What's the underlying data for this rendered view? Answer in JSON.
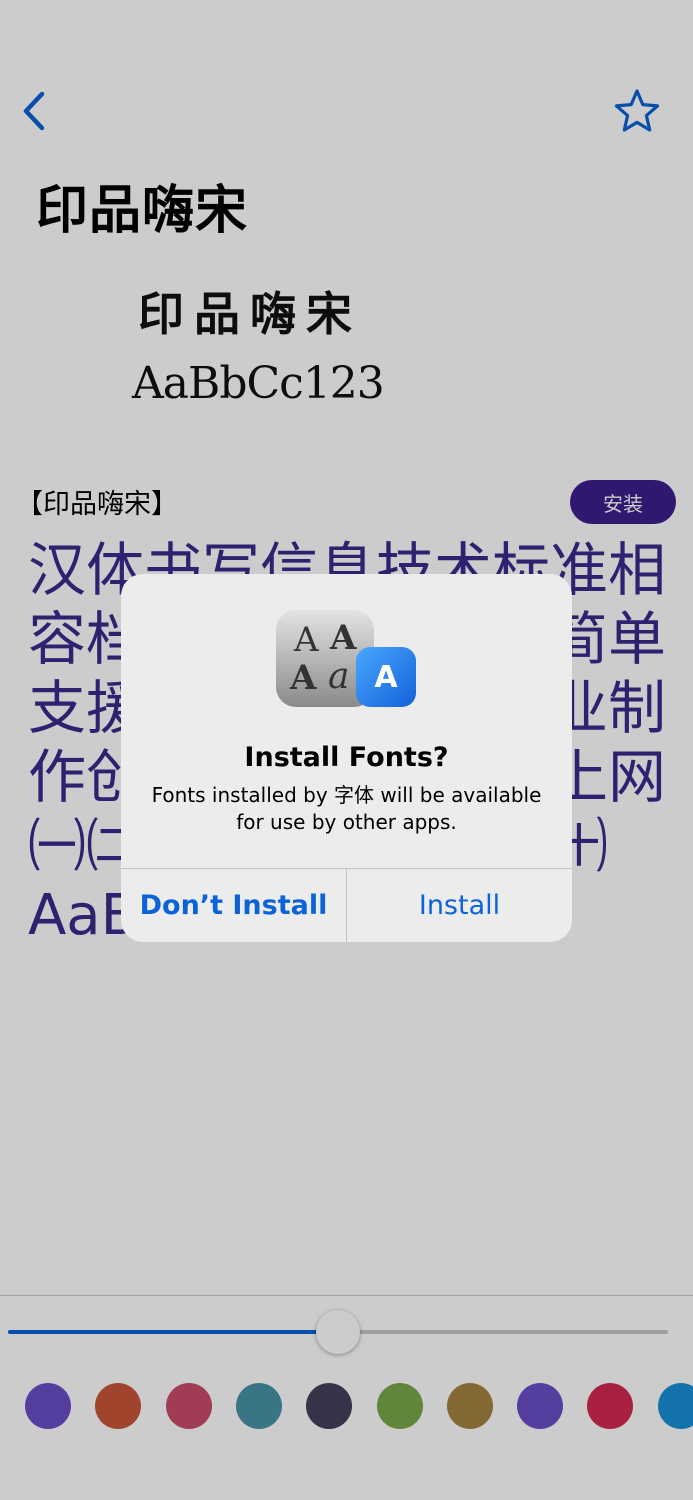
{
  "header": {
    "back_icon": "chevron-left-icon",
    "favorite_icon": "star-outline-icon",
    "title": "印品嗨宋"
  },
  "preview": {
    "chinese": "印品嗨宋",
    "latin": "AaBbCc123"
  },
  "font_row": {
    "label": "【印品嗨宋】",
    "install_label": "安装"
  },
  "sample": {
    "text": "汉体书写信息技术标准相容档案下载使用界面简单支援服务升级资讯专业制作创意空间快速无线上网㈠㈡㈢㈣㈤㈥㈦㈧㈨㈩",
    "latin": "AaBbCc"
  },
  "size_slider": {
    "value_fraction": 0.5,
    "track_color": "#c7c7c7",
    "fill_color": "#0a63d8"
  },
  "colors": [
    "#6b4fc6",
    "#c8553a",
    "#c94b6a",
    "#4893a6",
    "#44405a",
    "#77a84a",
    "#a68340",
    "#6b4fc6",
    "#d22a52",
    "#1a8fd6"
  ],
  "alert": {
    "title": "Install Fonts?",
    "message": "Fonts installed by 字体 will be available for use by other apps.",
    "cancel_label": "Don’t Install",
    "confirm_label": "Install",
    "icon_glyphs": [
      "A",
      "A",
      "A",
      "a"
    ],
    "badge_glyph": "A"
  },
  "accent_color": "#0a63d8"
}
